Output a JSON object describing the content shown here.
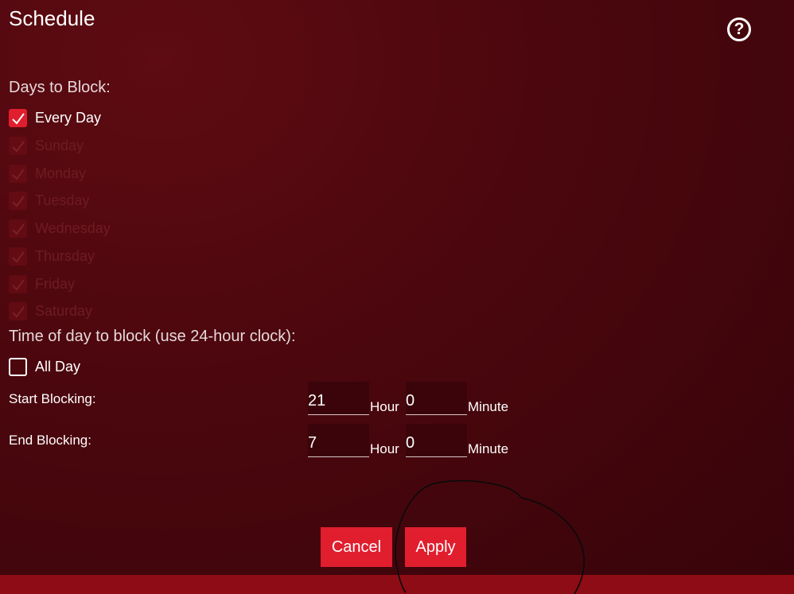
{
  "header": {
    "title": "Schedule",
    "help_icon": "question-circle-icon"
  },
  "days": {
    "label": "Days to Block:",
    "items": [
      {
        "label": "Every Day",
        "checked": true,
        "disabled": false
      },
      {
        "label": "Sunday",
        "checked": true,
        "disabled": true
      },
      {
        "label": "Monday",
        "checked": true,
        "disabled": true
      },
      {
        "label": "Tuesday",
        "checked": true,
        "disabled": true
      },
      {
        "label": "Wednesday",
        "checked": true,
        "disabled": true
      },
      {
        "label": "Thursday",
        "checked": true,
        "disabled": true
      },
      {
        "label": "Friday",
        "checked": true,
        "disabled": true
      },
      {
        "label": "Saturday",
        "checked": true,
        "disabled": true
      }
    ]
  },
  "time": {
    "label": "Time of day to block (use 24-hour clock):",
    "all_day": {
      "label": "All Day",
      "checked": false
    },
    "start": {
      "label": "Start Blocking:",
      "hour": "21",
      "minute": "0"
    },
    "end": {
      "label": "End Blocking:",
      "hour": "7",
      "minute": "0"
    },
    "hour_unit": "Hour",
    "minute_unit": "Minute"
  },
  "buttons": {
    "cancel": "Cancel",
    "apply": "Apply"
  },
  "colors": {
    "accent": "#e01e2e",
    "background": "#4d070e",
    "footer": "#8e0c15"
  }
}
